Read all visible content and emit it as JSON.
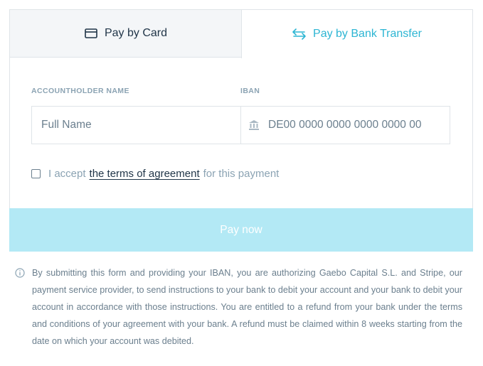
{
  "tabs": {
    "card_label": "Pay by Card",
    "bank_label": "Pay by Bank Transfer"
  },
  "form": {
    "accountholder_label": "ACCOUNTHOLDER NAME",
    "iban_label": "IBAN",
    "name_placeholder": "Full Name",
    "iban_placeholder": "DE00 0000 0000 0000 0000 00"
  },
  "accept": {
    "prefix": "I accept",
    "link": "the terms of agreement",
    "suffix": "for this payment"
  },
  "pay_button": "Pay now",
  "disclaimer": "By submitting this form and providing your IBAN, you are authorizing Gaebo Capital S.L. and Stripe, our payment service provider, to send instructions to your bank to debit your account and your bank to debit your account in accordance with those instructions. You are entitled to a refund from your bank under the terms and conditions of your agreement with your bank. A refund must be claimed within 8 weeks starting from the date on which your account was debited.",
  "colors": {
    "accent": "#2cb5d3",
    "button_disabled": "#b3e9f5",
    "text_dark": "#1f3447",
    "text_muted": "#8ba3b3"
  },
  "icons": {
    "card_tab": "credit-card-icon",
    "bank_tab": "transfer-arrows-icon",
    "iban_field": "bank-icon",
    "disclaimer": "info-icon"
  }
}
